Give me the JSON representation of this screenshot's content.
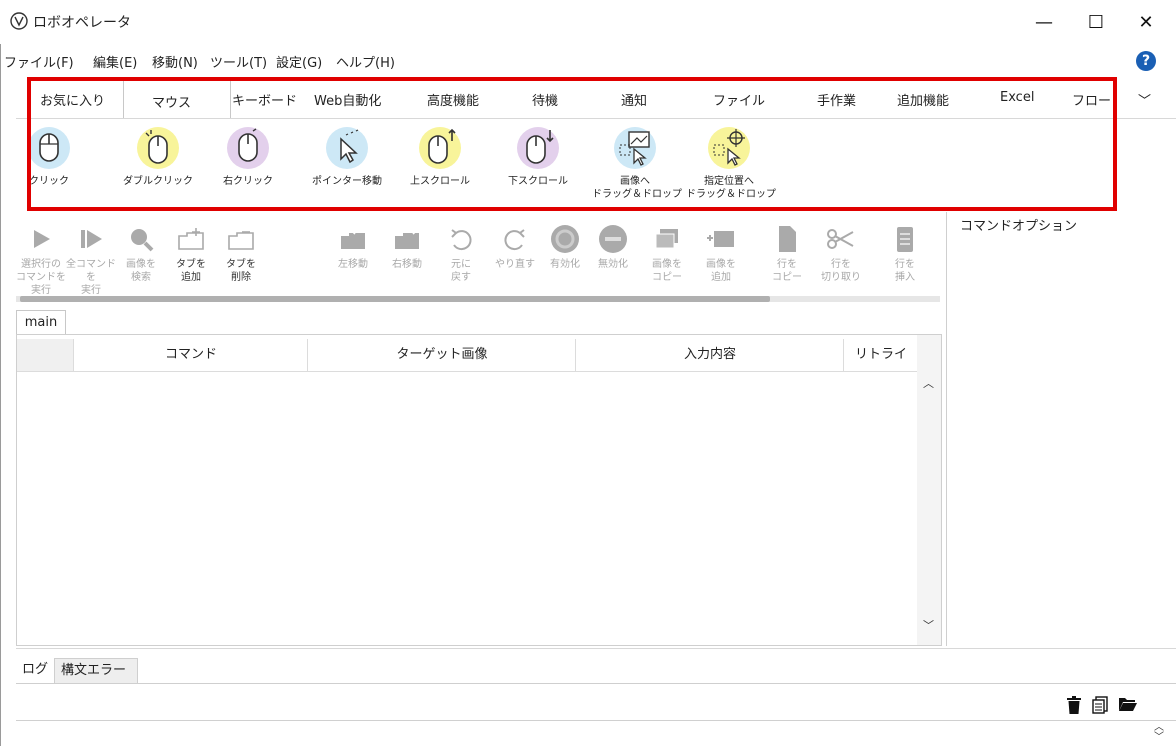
{
  "window": {
    "title": "ロボオペレータ",
    "minimize": "—",
    "maximize": "☐",
    "close": "✕"
  },
  "menubar": [
    "ファイル(F)",
    "編集(E)",
    "移動(N)",
    "ツール(T)",
    "設定(G)",
    "ヘルプ(H)"
  ],
  "help_icon": "?",
  "ribbon": {
    "tabs": [
      "お気に入り",
      "マウス",
      "キーボード",
      "Web自動化",
      "高度機能",
      "待機",
      "通知",
      "ファイル",
      "手作業",
      "追加機能",
      "Excel",
      "フロー"
    ],
    "active_tab": "マウス",
    "overflow": "﹀",
    "buttons": [
      {
        "label": "クリック",
        "icon": "mouse-click-icon",
        "color": "#cde8f6"
      },
      {
        "label": "ダブルクリック",
        "icon": "mouse-double-click-icon",
        "color": "#f8f49a"
      },
      {
        "label": "右クリック",
        "icon": "mouse-right-click-icon",
        "color": "#e3d0ec"
      },
      {
        "label": "ポインター移動",
        "icon": "pointer-move-icon",
        "color": "#cde8f6"
      },
      {
        "label": "上スクロール",
        "icon": "scroll-up-icon",
        "color": "#f8f49a"
      },
      {
        "label": "下スクロール",
        "icon": "scroll-down-icon",
        "color": "#e3d0ec"
      },
      {
        "label": "画像へ",
        "label2": "ドラッグ＆ドロップ",
        "icon": "drag-to-image-icon",
        "color": "#cde8f6"
      },
      {
        "label": "指定位置へ",
        "label2": "ドラッグ＆ドロップ",
        "icon": "drag-to-position-icon",
        "color": "#f8f49a"
      }
    ]
  },
  "toolbar": [
    {
      "l1": "選択行の",
      "l2": "コマンドを実行",
      "icon": "run-selected-icon"
    },
    {
      "l1": "全コマンドを",
      "l2": "実行",
      "icon": "run-all-icon"
    },
    {
      "l1": "画像を",
      "l2": "検索",
      "icon": "search-image-icon"
    },
    {
      "l1": "タブを",
      "l2": "追加",
      "icon": "add-tab-icon",
      "dark": true
    },
    {
      "l1": "タブを",
      "l2": "削除",
      "icon": "delete-tab-icon",
      "dark": true
    },
    {
      "l1": "左移動",
      "l2": "",
      "icon": "move-left-icon"
    },
    {
      "l1": "右移動",
      "l2": "",
      "icon": "move-right-icon"
    },
    {
      "l1": "元に",
      "l2": "戻す",
      "icon": "undo-icon"
    },
    {
      "l1": "やり直す",
      "l2": "",
      "icon": "redo-icon"
    },
    {
      "l1": "有効化",
      "l2": "",
      "icon": "enable-icon"
    },
    {
      "l1": "無効化",
      "l2": "",
      "icon": "disable-icon"
    },
    {
      "l1": "画像を",
      "l2": "コピー",
      "icon": "copy-image-icon"
    },
    {
      "l1": "画像を",
      "l2": "追加",
      "icon": "add-image-icon"
    },
    {
      "l1": "行を",
      "l2": "コピー",
      "icon": "copy-row-icon"
    },
    {
      "l1": "行を",
      "l2": "切り取り",
      "icon": "cut-row-icon"
    },
    {
      "l1": "行を",
      "l2": "挿入",
      "icon": "insert-row-icon"
    }
  ],
  "options_label": "コマンドオプション",
  "editor": {
    "tab": "main",
    "columns": [
      "コマンド",
      "ターゲット画像",
      "入力内容",
      "リトライ"
    ]
  },
  "log": {
    "tabs": [
      "ログ",
      "構文エラー"
    ]
  }
}
